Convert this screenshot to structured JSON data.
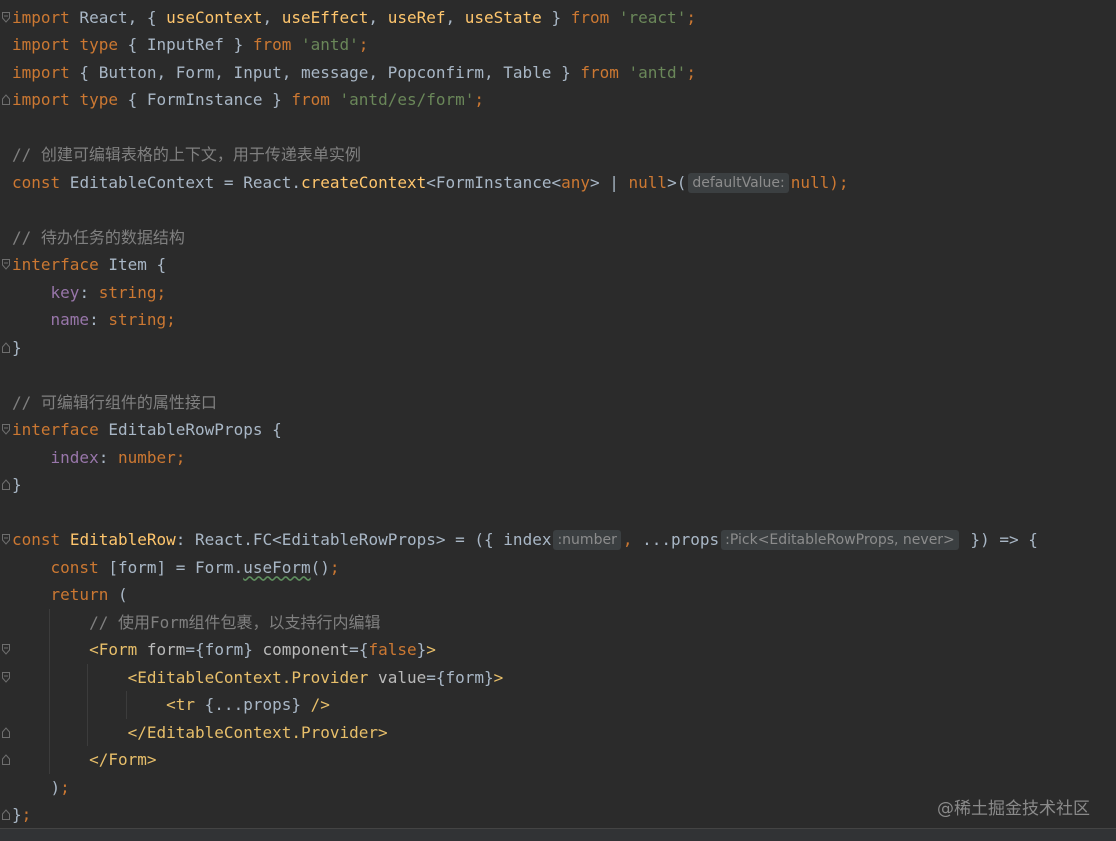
{
  "editor": {
    "lines": [
      {
        "fold": "open",
        "tokens": [
          {
            "t": "import",
            "c": "kw"
          },
          {
            "t": " React, { ",
            "c": "plain"
          },
          {
            "t": "useContext",
            "c": "fn"
          },
          {
            "t": ", ",
            "c": "plain"
          },
          {
            "t": "useEffect",
            "c": "fn"
          },
          {
            "t": ", ",
            "c": "plain"
          },
          {
            "t": "useRef",
            "c": "fn"
          },
          {
            "t": ", ",
            "c": "plain"
          },
          {
            "t": "useState",
            "c": "fn"
          },
          {
            "t": " } ",
            "c": "plain"
          },
          {
            "t": "from",
            "c": "kw"
          },
          {
            "t": " ",
            "c": "plain"
          },
          {
            "t": "'react'",
            "c": "str"
          },
          {
            "t": ";",
            "c": "kw"
          }
        ]
      },
      {
        "fold": "",
        "tokens": [
          {
            "t": "import",
            "c": "kw"
          },
          {
            "t": " ",
            "c": "plain"
          },
          {
            "t": "type",
            "c": "kw"
          },
          {
            "t": " { InputRef } ",
            "c": "plain"
          },
          {
            "t": "from",
            "c": "kw"
          },
          {
            "t": " ",
            "c": "plain"
          },
          {
            "t": "'antd'",
            "c": "str"
          },
          {
            "t": ";",
            "c": "kw"
          }
        ]
      },
      {
        "fold": "",
        "tokens": [
          {
            "t": "import",
            "c": "kw"
          },
          {
            "t": " { Button, Form, Input, message, Popconfirm, Table } ",
            "c": "plain"
          },
          {
            "t": "from",
            "c": "kw"
          },
          {
            "t": " ",
            "c": "plain"
          },
          {
            "t": "'antd'",
            "c": "str"
          },
          {
            "t": ";",
            "c": "kw"
          }
        ]
      },
      {
        "fold": "close",
        "tokens": [
          {
            "t": "import",
            "c": "kw"
          },
          {
            "t": " ",
            "c": "plain"
          },
          {
            "t": "type",
            "c": "kw"
          },
          {
            "t": " { FormInstance } ",
            "c": "plain"
          },
          {
            "t": "from",
            "c": "kw"
          },
          {
            "t": " ",
            "c": "plain"
          },
          {
            "t": "'antd/es/form'",
            "c": "str"
          },
          {
            "t": ";",
            "c": "kw"
          }
        ]
      },
      {
        "fold": "",
        "tokens": []
      },
      {
        "fold": "",
        "tokens": [
          {
            "t": "// 创建可编辑表格的上下文，用于传递表单实例",
            "c": "cmt"
          }
        ]
      },
      {
        "fold": "",
        "tokens": [
          {
            "t": "const",
            "c": "kw"
          },
          {
            "t": " EditableContext = React.",
            "c": "plain"
          },
          {
            "t": "createContext",
            "c": "fn"
          },
          {
            "t": "<FormInstance<",
            "c": "plain"
          },
          {
            "t": "any",
            "c": "kw"
          },
          {
            "t": "> | ",
            "c": "plain"
          },
          {
            "t": "null",
            "c": "kw"
          },
          {
            "t": ">(",
            "c": "plain"
          },
          {
            "t": "defaultValue:",
            "c": "hint"
          },
          {
            "t": "null",
            "c": "kw"
          },
          {
            "t": ");",
            "c": "kw"
          }
        ]
      },
      {
        "fold": "",
        "tokens": []
      },
      {
        "fold": "",
        "tokens": [
          {
            "t": "// 待办任务的数据结构",
            "c": "cmt"
          }
        ]
      },
      {
        "fold": "open",
        "tokens": [
          {
            "t": "interface",
            "c": "kw"
          },
          {
            "t": " Item {",
            "c": "plain"
          }
        ]
      },
      {
        "fold": "",
        "tokens": [
          {
            "t": "    ",
            "c": "plain"
          },
          {
            "t": "key",
            "c": "prop"
          },
          {
            "t": ": ",
            "c": "plain"
          },
          {
            "t": "string",
            "c": "kw"
          },
          {
            "t": ";",
            "c": "kw"
          }
        ]
      },
      {
        "fold": "",
        "tokens": [
          {
            "t": "    ",
            "c": "plain"
          },
          {
            "t": "name",
            "c": "prop"
          },
          {
            "t": ": ",
            "c": "plain"
          },
          {
            "t": "string",
            "c": "kw"
          },
          {
            "t": ";",
            "c": "kw"
          }
        ]
      },
      {
        "fold": "close",
        "tokens": [
          {
            "t": "}",
            "c": "plain"
          }
        ]
      },
      {
        "fold": "",
        "tokens": []
      },
      {
        "fold": "",
        "tokens": [
          {
            "t": "// 可编辑行组件的属性接口",
            "c": "cmt"
          }
        ]
      },
      {
        "fold": "open",
        "tokens": [
          {
            "t": "interface",
            "c": "kw"
          },
          {
            "t": " EditableRowProps {",
            "c": "plain"
          }
        ]
      },
      {
        "fold": "",
        "tokens": [
          {
            "t": "    ",
            "c": "plain"
          },
          {
            "t": "index",
            "c": "prop"
          },
          {
            "t": ": ",
            "c": "plain"
          },
          {
            "t": "number",
            "c": "kw"
          },
          {
            "t": ";",
            "c": "kw"
          }
        ]
      },
      {
        "fold": "close",
        "tokens": [
          {
            "t": "}",
            "c": "plain"
          }
        ]
      },
      {
        "fold": "",
        "tokens": []
      },
      {
        "fold": "open",
        "tokens": [
          {
            "t": "const",
            "c": "kw"
          },
          {
            "t": " ",
            "c": "plain"
          },
          {
            "t": "EditableRow",
            "c": "fn"
          },
          {
            "t": ": React.FC<EditableRowProps> = ({ index",
            "c": "plain"
          },
          {
            "t": ":number",
            "c": "hint"
          },
          {
            "t": ", ",
            "c": "kw"
          },
          {
            "t": "...props",
            "c": "plain"
          },
          {
            "t": ":Pick<EditableRowProps, never>",
            "c": "hint"
          },
          {
            "t": " }) => {",
            "c": "plain"
          }
        ]
      },
      {
        "fold": "",
        "tokens": [
          {
            "t": "    ",
            "c": "plain"
          },
          {
            "t": "const",
            "c": "kw"
          },
          {
            "t": " [form] = Form.",
            "c": "plain"
          },
          {
            "t": "useForm",
            "c": "ul"
          },
          {
            "t": "()",
            "c": "plain"
          },
          {
            "t": ";",
            "c": "kw"
          }
        ]
      },
      {
        "fold": "",
        "tokens": [
          {
            "t": "    ",
            "c": "plain"
          },
          {
            "t": "return",
            "c": "kw"
          },
          {
            "t": " (",
            "c": "plain"
          }
        ]
      },
      {
        "fold": "",
        "guides": [
          1
        ],
        "tokens": [
          {
            "t": "        ",
            "c": "plain"
          },
          {
            "t": "// 使用Form组件包裹，以支持行内编辑",
            "c": "cmt"
          }
        ]
      },
      {
        "fold": "open",
        "guides": [
          1
        ],
        "tokens": [
          {
            "t": "        ",
            "c": "plain"
          },
          {
            "t": "<Form",
            "c": "tag"
          },
          {
            "t": " form",
            "c": "attr"
          },
          {
            "t": "=",
            "c": "plain"
          },
          {
            "t": "{form}",
            "c": "plain"
          },
          {
            "t": " component",
            "c": "attr"
          },
          {
            "t": "=",
            "c": "plain"
          },
          {
            "t": "{",
            "c": "plain"
          },
          {
            "t": "false",
            "c": "kw"
          },
          {
            "t": "}",
            "c": "plain"
          },
          {
            "t": ">",
            "c": "tag"
          }
        ]
      },
      {
        "fold": "open",
        "guides": [
          1,
          2
        ],
        "tokens": [
          {
            "t": "            ",
            "c": "plain"
          },
          {
            "t": "<EditableContext.Provider",
            "c": "tag"
          },
          {
            "t": " value",
            "c": "attr"
          },
          {
            "t": "=",
            "c": "plain"
          },
          {
            "t": "{form}",
            "c": "plain"
          },
          {
            "t": ">",
            "c": "tag"
          }
        ]
      },
      {
        "fold": "",
        "guides": [
          1,
          2,
          3
        ],
        "tokens": [
          {
            "t": "                ",
            "c": "plain"
          },
          {
            "t": "<tr",
            "c": "tag"
          },
          {
            "t": " {...props} ",
            "c": "plain"
          },
          {
            "t": "/>",
            "c": "tag"
          }
        ]
      },
      {
        "fold": "close",
        "guides": [
          1,
          2
        ],
        "tokens": [
          {
            "t": "            ",
            "c": "plain"
          },
          {
            "t": "</EditableContext.Provider>",
            "c": "tag"
          }
        ]
      },
      {
        "fold": "close",
        "guides": [
          1
        ],
        "tokens": [
          {
            "t": "        ",
            "c": "plain"
          },
          {
            "t": "</Form>",
            "c": "tag"
          }
        ]
      },
      {
        "fold": "",
        "tokens": [
          {
            "t": "    ",
            "c": "plain"
          },
          {
            "t": ")",
            "c": "plain"
          },
          {
            "t": ";",
            "c": "kw"
          }
        ]
      },
      {
        "fold": "close",
        "tokens": [
          {
            "t": "}",
            "c": "plain"
          },
          {
            "t": ";",
            "c": "kw"
          }
        ]
      }
    ]
  },
  "watermark": "@稀土掘金技术社区",
  "colors": {
    "background": "#2b2b2b",
    "keyword": "#cc7832",
    "string": "#6a8759",
    "function": "#ffc66d",
    "property": "#9876aa",
    "tag": "#e8bf6a",
    "comment": "#808080",
    "text": "#a9b7c6",
    "hint_bg": "#3b3f41"
  }
}
